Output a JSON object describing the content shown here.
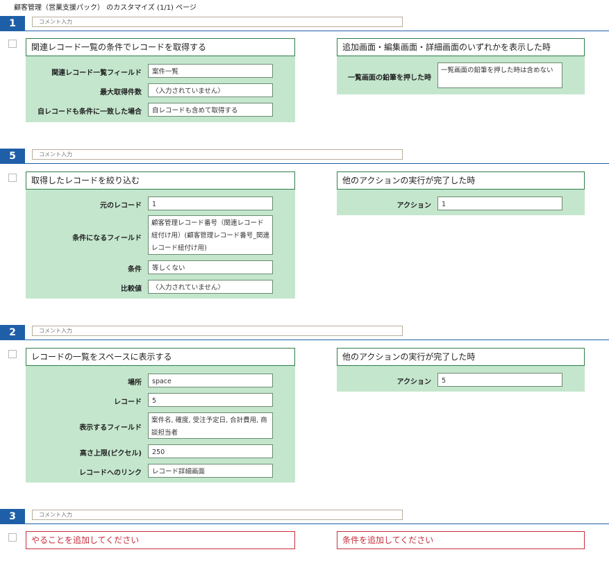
{
  "page": {
    "title": "顧客管理（営業支援パック） のカスタマイズ (1/1) ページ"
  },
  "steps": [
    {
      "number": "1",
      "comment_placeholder": "コメント入力",
      "action": {
        "title": "関連レコード一覧の条件でレコードを取得する",
        "rows": [
          {
            "label": "関連レコード一覧フィールド",
            "value": "案件一覧"
          },
          {
            "label": "最大取得件数",
            "value": "〈入力されていません〉"
          },
          {
            "label": "自レコードも条件に一致した場合",
            "value": "自レコードも含めて取得する"
          }
        ]
      },
      "condition": {
        "title": "追加画面・編集画面・詳細画面のいずれかを表示した時",
        "rows": [
          {
            "label": "一覧画面の鉛筆を押した時",
            "value": "一覧画面の鉛筆を押した時は含めない"
          }
        ]
      }
    },
    {
      "number": "5",
      "comment_placeholder": "コメント入力",
      "action": {
        "title": "取得したレコードを絞り込む",
        "rows": [
          {
            "label": "元のレコード",
            "value": "1"
          },
          {
            "label": "条件になるフィールド",
            "value": "顧客管理レコード番号（関連レコード紐付け用）(顧客管理レコード番号_関連レコード紐付け用)"
          },
          {
            "label": "条件",
            "value": "等しくない"
          },
          {
            "label": "比較値",
            "value": "〈入力されていません〉"
          }
        ]
      },
      "condition": {
        "title": "他のアクションの実行が完了した時",
        "rows": [
          {
            "label": "アクション",
            "value": "1"
          }
        ]
      }
    },
    {
      "number": "2",
      "comment_placeholder": "コメント入力",
      "action": {
        "title": "レコードの一覧をスペースに表示する",
        "rows": [
          {
            "label": "場所",
            "value": "space"
          },
          {
            "label": "レコード",
            "value": "5"
          },
          {
            "label": "表示するフィールド",
            "value": "案件名, 確度, 受注予定日, 合計費用, 商談担当者"
          },
          {
            "label": "高さ上限(ピクセル)",
            "value": "250"
          },
          {
            "label": "レコードへのリンク",
            "value": "レコード詳細画面"
          }
        ]
      },
      "condition": {
        "title": "他のアクションの実行が完了した時",
        "rows": [
          {
            "label": "アクション",
            "value": "5"
          }
        ]
      }
    },
    {
      "number": "3",
      "comment_placeholder": "コメント入力",
      "action": {
        "title": "やることを追加してください"
      },
      "condition": {
        "title": "条件を追加してください"
      }
    }
  ],
  "colors": {
    "step_accent": "#1f5fa8",
    "card_border": "#2e7d46",
    "card_body": "#c4e6cd",
    "empty_card": "#c62d3c"
  }
}
